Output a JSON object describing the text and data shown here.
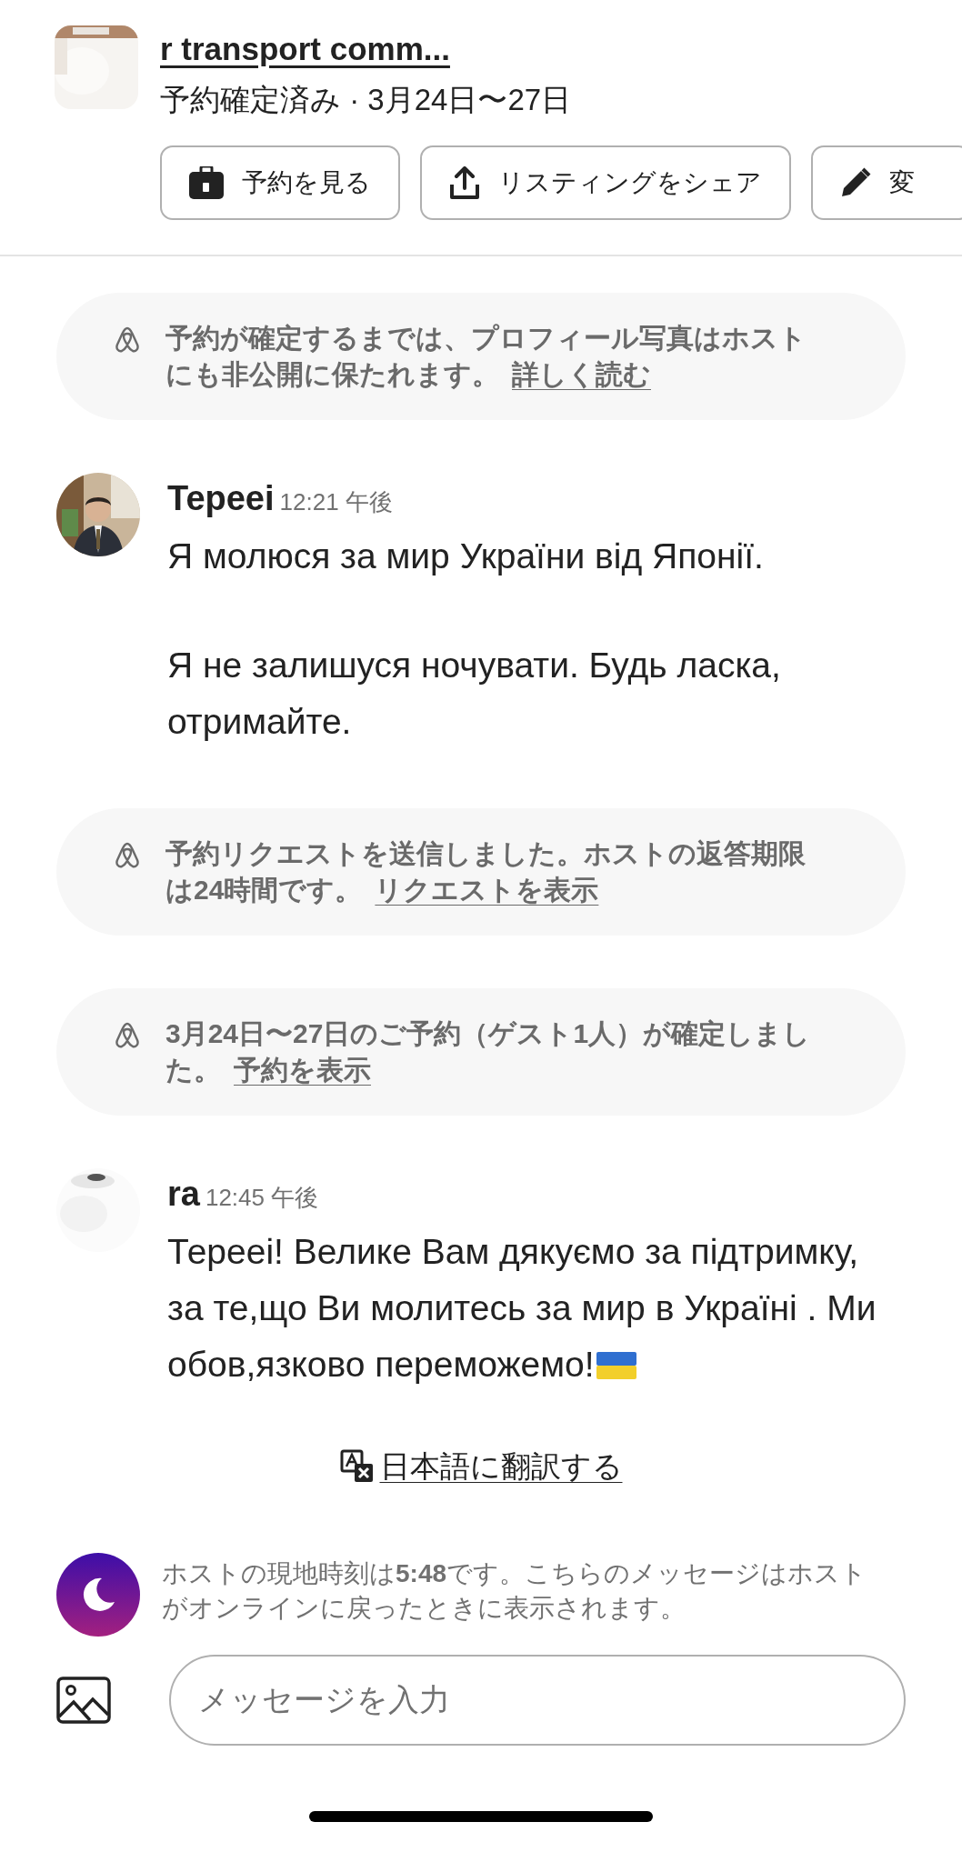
{
  "listing": {
    "title": "r transport comm...",
    "status": "予約確定済み · 3月24日〜27日",
    "actions": [
      {
        "kind": "trip",
        "label": "予約を見る"
      },
      {
        "kind": "share",
        "label": "リスティングをシェア"
      },
      {
        "kind": "edit",
        "label": "変"
      }
    ]
  },
  "thread": [
    {
      "kind": "notice",
      "text": "予約が確定するまでは、プロフィール写真はホストにも非公開に保たれます。",
      "link": "詳しく読む"
    },
    {
      "kind": "message",
      "sender": "Tepeei",
      "time": "12:21 午後",
      "paragraphs": [
        "Я молюся за мир України від Японії.",
        "Я не залишуся ночувати. Будь ласка, отримайте."
      ],
      "flag": false
    },
    {
      "kind": "notice",
      "text": "予約リクエストを送信しました。ホストの返答期限は24時間です。",
      "link": "リクエストを表示"
    },
    {
      "kind": "notice",
      "text": "3月24日〜27日のご予約（ゲスト1人）が確定しました。",
      "link": "予約を表示"
    },
    {
      "kind": "message",
      "sender": "ra",
      "time": "12:45 午後",
      "paragraphs": [
        "Терееі! Велике Вам дякуємо за підтримку, за те,що Ви молитесь за мир в Україні . Ми обов,язково переможемо!"
      ],
      "flag": true
    }
  ],
  "translate": {
    "label": "日本語に翻訳する"
  },
  "host_time_note": "ホストの現地時刻は**5:48**です。こちらのメッセージはホストがオンラインに戻ったときに表示されます。",
  "composer": {
    "placeholder": "メッセージを入力"
  }
}
